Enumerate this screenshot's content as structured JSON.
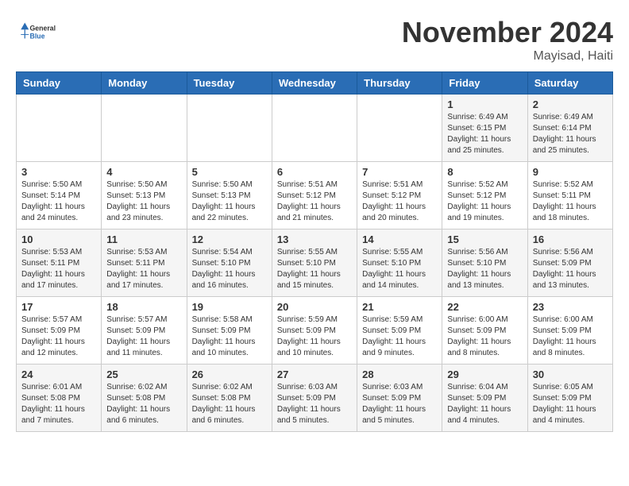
{
  "header": {
    "logo": {
      "general": "General",
      "blue": "Blue"
    },
    "month": "November 2024",
    "location": "Mayisad, Haiti"
  },
  "weekdays": [
    "Sunday",
    "Monday",
    "Tuesday",
    "Wednesday",
    "Thursday",
    "Friday",
    "Saturday"
  ],
  "weeks": [
    [
      {
        "day": "",
        "sunrise": "",
        "sunset": "",
        "daylight": ""
      },
      {
        "day": "",
        "sunrise": "",
        "sunset": "",
        "daylight": ""
      },
      {
        "day": "",
        "sunrise": "",
        "sunset": "",
        "daylight": ""
      },
      {
        "day": "",
        "sunrise": "",
        "sunset": "",
        "daylight": ""
      },
      {
        "day": "",
        "sunrise": "",
        "sunset": "",
        "daylight": ""
      },
      {
        "day": "1",
        "sunrise": "Sunrise: 6:49 AM",
        "sunset": "Sunset: 6:15 PM",
        "daylight": "Daylight: 11 hours and 25 minutes."
      },
      {
        "day": "2",
        "sunrise": "Sunrise: 6:49 AM",
        "sunset": "Sunset: 6:14 PM",
        "daylight": "Daylight: 11 hours and 25 minutes."
      }
    ],
    [
      {
        "day": "3",
        "sunrise": "Sunrise: 5:50 AM",
        "sunset": "Sunset: 5:14 PM",
        "daylight": "Daylight: 11 hours and 24 minutes."
      },
      {
        "day": "4",
        "sunrise": "Sunrise: 5:50 AM",
        "sunset": "Sunset: 5:13 PM",
        "daylight": "Daylight: 11 hours and 23 minutes."
      },
      {
        "day": "5",
        "sunrise": "Sunrise: 5:50 AM",
        "sunset": "Sunset: 5:13 PM",
        "daylight": "Daylight: 11 hours and 22 minutes."
      },
      {
        "day": "6",
        "sunrise": "Sunrise: 5:51 AM",
        "sunset": "Sunset: 5:12 PM",
        "daylight": "Daylight: 11 hours and 21 minutes."
      },
      {
        "day": "7",
        "sunrise": "Sunrise: 5:51 AM",
        "sunset": "Sunset: 5:12 PM",
        "daylight": "Daylight: 11 hours and 20 minutes."
      },
      {
        "day": "8",
        "sunrise": "Sunrise: 5:52 AM",
        "sunset": "Sunset: 5:12 PM",
        "daylight": "Daylight: 11 hours and 19 minutes."
      },
      {
        "day": "9",
        "sunrise": "Sunrise: 5:52 AM",
        "sunset": "Sunset: 5:11 PM",
        "daylight": "Daylight: 11 hours and 18 minutes."
      }
    ],
    [
      {
        "day": "10",
        "sunrise": "Sunrise: 5:53 AM",
        "sunset": "Sunset: 5:11 PM",
        "daylight": "Daylight: 11 hours and 17 minutes."
      },
      {
        "day": "11",
        "sunrise": "Sunrise: 5:53 AM",
        "sunset": "Sunset: 5:11 PM",
        "daylight": "Daylight: 11 hours and 17 minutes."
      },
      {
        "day": "12",
        "sunrise": "Sunrise: 5:54 AM",
        "sunset": "Sunset: 5:10 PM",
        "daylight": "Daylight: 11 hours and 16 minutes."
      },
      {
        "day": "13",
        "sunrise": "Sunrise: 5:55 AM",
        "sunset": "Sunset: 5:10 PM",
        "daylight": "Daylight: 11 hours and 15 minutes."
      },
      {
        "day": "14",
        "sunrise": "Sunrise: 5:55 AM",
        "sunset": "Sunset: 5:10 PM",
        "daylight": "Daylight: 11 hours and 14 minutes."
      },
      {
        "day": "15",
        "sunrise": "Sunrise: 5:56 AM",
        "sunset": "Sunset: 5:10 PM",
        "daylight": "Daylight: 11 hours and 13 minutes."
      },
      {
        "day": "16",
        "sunrise": "Sunrise: 5:56 AM",
        "sunset": "Sunset: 5:09 PM",
        "daylight": "Daylight: 11 hours and 13 minutes."
      }
    ],
    [
      {
        "day": "17",
        "sunrise": "Sunrise: 5:57 AM",
        "sunset": "Sunset: 5:09 PM",
        "daylight": "Daylight: 11 hours and 12 minutes."
      },
      {
        "day": "18",
        "sunrise": "Sunrise: 5:57 AM",
        "sunset": "Sunset: 5:09 PM",
        "daylight": "Daylight: 11 hours and 11 minutes."
      },
      {
        "day": "19",
        "sunrise": "Sunrise: 5:58 AM",
        "sunset": "Sunset: 5:09 PM",
        "daylight": "Daylight: 11 hours and 10 minutes."
      },
      {
        "day": "20",
        "sunrise": "Sunrise: 5:59 AM",
        "sunset": "Sunset: 5:09 PM",
        "daylight": "Daylight: 11 hours and 10 minutes."
      },
      {
        "day": "21",
        "sunrise": "Sunrise: 5:59 AM",
        "sunset": "Sunset: 5:09 PM",
        "daylight": "Daylight: 11 hours and 9 minutes."
      },
      {
        "day": "22",
        "sunrise": "Sunrise: 6:00 AM",
        "sunset": "Sunset: 5:09 PM",
        "daylight": "Daylight: 11 hours and 8 minutes."
      },
      {
        "day": "23",
        "sunrise": "Sunrise: 6:00 AM",
        "sunset": "Sunset: 5:09 PM",
        "daylight": "Daylight: 11 hours and 8 minutes."
      }
    ],
    [
      {
        "day": "24",
        "sunrise": "Sunrise: 6:01 AM",
        "sunset": "Sunset: 5:08 PM",
        "daylight": "Daylight: 11 hours and 7 minutes."
      },
      {
        "day": "25",
        "sunrise": "Sunrise: 6:02 AM",
        "sunset": "Sunset: 5:08 PM",
        "daylight": "Daylight: 11 hours and 6 minutes."
      },
      {
        "day": "26",
        "sunrise": "Sunrise: 6:02 AM",
        "sunset": "Sunset: 5:08 PM",
        "daylight": "Daylight: 11 hours and 6 minutes."
      },
      {
        "day": "27",
        "sunrise": "Sunrise: 6:03 AM",
        "sunset": "Sunset: 5:09 PM",
        "daylight": "Daylight: 11 hours and 5 minutes."
      },
      {
        "day": "28",
        "sunrise": "Sunrise: 6:03 AM",
        "sunset": "Sunset: 5:09 PM",
        "daylight": "Daylight: 11 hours and 5 minutes."
      },
      {
        "day": "29",
        "sunrise": "Sunrise: 6:04 AM",
        "sunset": "Sunset: 5:09 PM",
        "daylight": "Daylight: 11 hours and 4 minutes."
      },
      {
        "day": "30",
        "sunrise": "Sunrise: 6:05 AM",
        "sunset": "Sunset: 5:09 PM",
        "daylight": "Daylight: 11 hours and 4 minutes."
      }
    ]
  ]
}
